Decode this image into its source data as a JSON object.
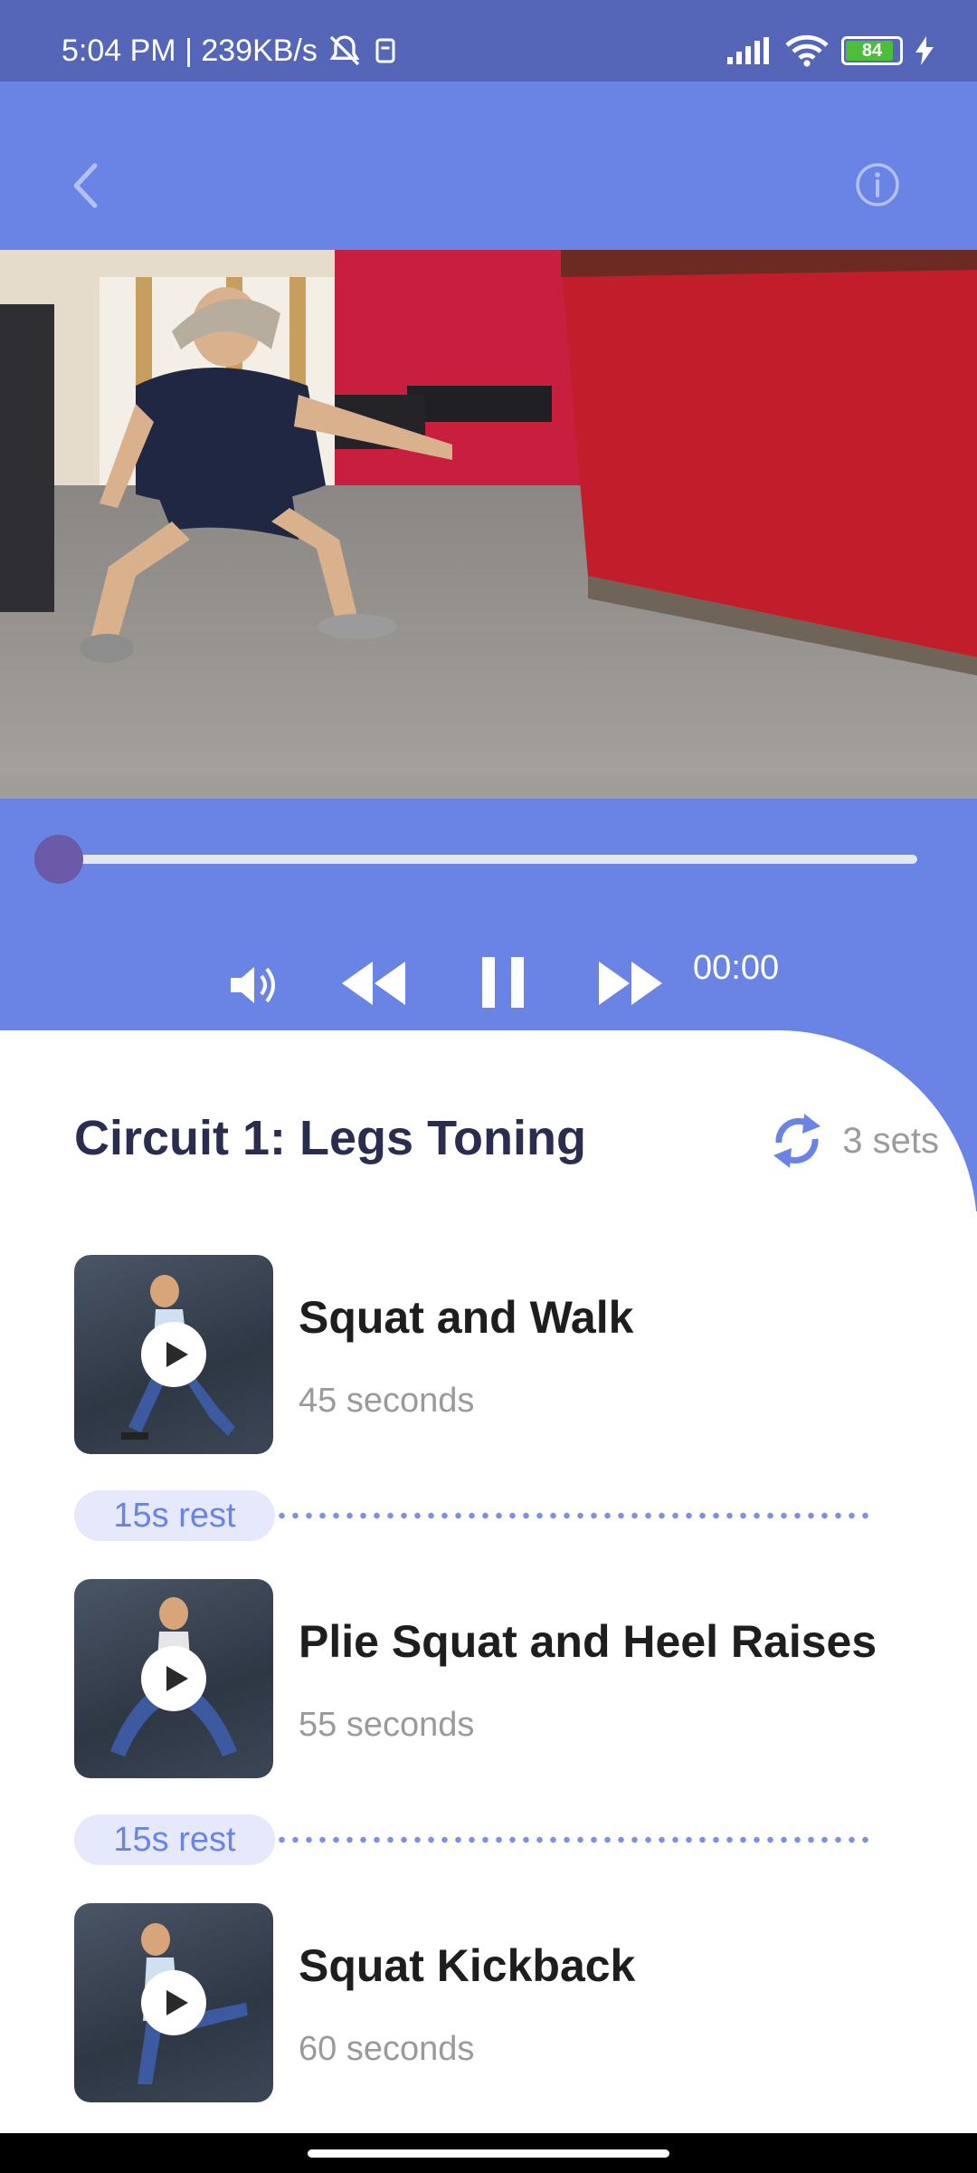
{
  "status_bar": {
    "time_speed": "5:04 PM | 239KB/s",
    "battery": "84"
  },
  "circuit": {
    "title": "Circuit 1: Legs Toning",
    "sets": "3 sets"
  },
  "player": {
    "elapsed": "00:00",
    "progress": 0
  },
  "exercises": [
    {
      "name": "Squat and Walk",
      "duration": "45 seconds"
    },
    {
      "name": "Plie Squat and Heel Raises",
      "duration": "55 seconds"
    },
    {
      "name": "Squat Kickback",
      "duration": "60 seconds"
    }
  ],
  "rests": [
    {
      "label": "15s rest"
    },
    {
      "label": "15s rest"
    }
  ],
  "colors": {
    "primary": "#6a84e6",
    "status_bar": "#5566b8",
    "title_text": "#2a2d4f",
    "seek_thumb": "#6a5aa8"
  },
  "icons": [
    "back-arrow-icon",
    "info-icon",
    "volume-icon",
    "rewind-icon",
    "pause-icon",
    "fast-forward-icon",
    "repeat-icon",
    "play-icon"
  ]
}
